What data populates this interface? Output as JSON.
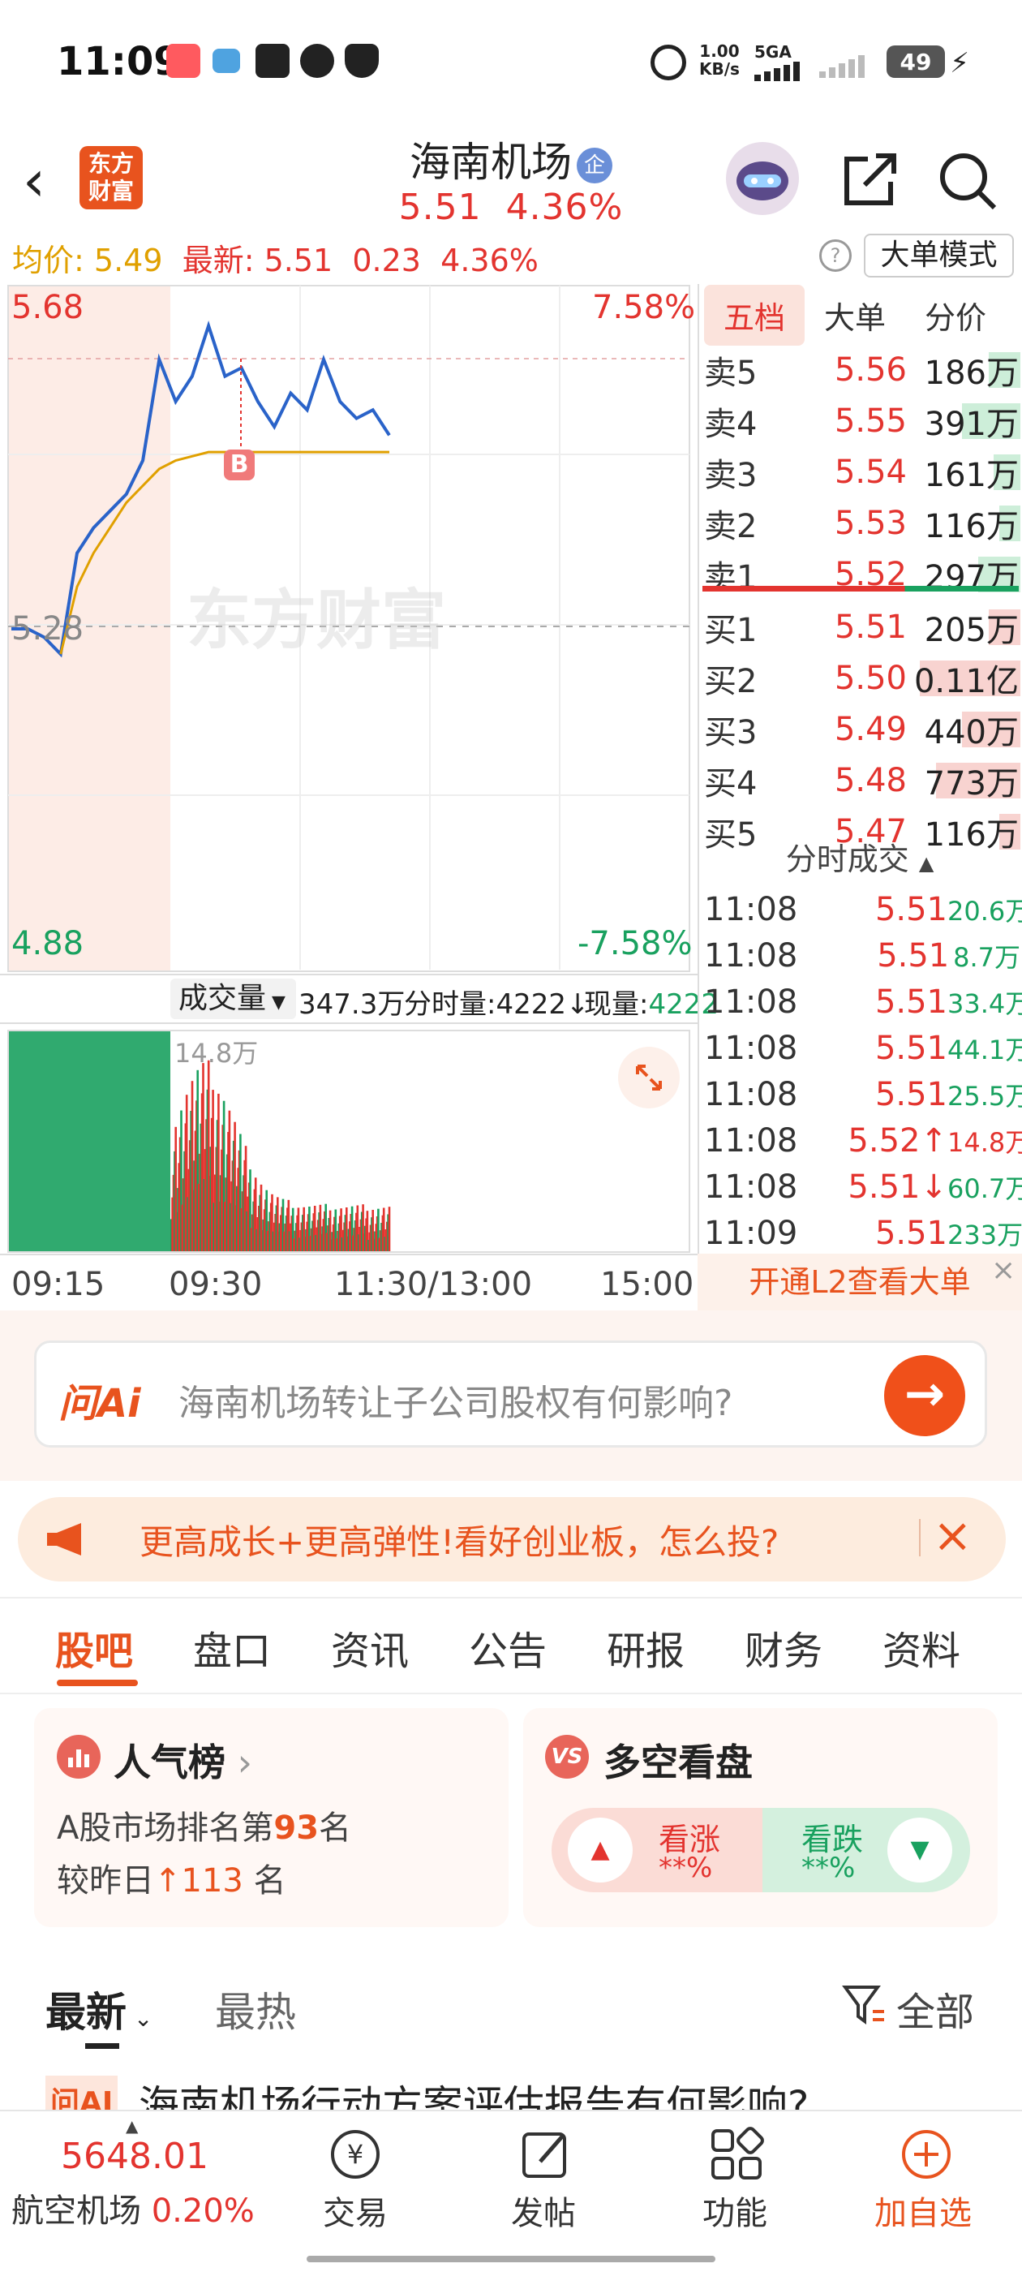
{
  "status_bar": {
    "time": "11:09",
    "net_speed": "1.00\nKB/s",
    "net_speed_top": "1.00",
    "net_speed_unit": "KB/s",
    "network": "5GA",
    "battery": "49"
  },
  "header": {
    "title": "海南机场",
    "badge": "企",
    "price": "5.51",
    "change_pct": "4.36%",
    "logo_line1": "东方",
    "logo_line2": "财富"
  },
  "info_row": {
    "avg_label": "均价:",
    "avg_value": "5.49",
    "latest_label": "最新:",
    "latest_value": "5.51",
    "change": "0.23",
    "change_pct": "4.36%",
    "mode_button": "大单模式"
  },
  "chart": {
    "price_high": "5.68",
    "price_mid": "5.28",
    "price_low": "4.88",
    "pct_high": "7.58%",
    "pct_low": "-7.58%",
    "watermark": "东方财富",
    "buy_marker": "B",
    "volume_label": "成交量",
    "volume_total": "347.3万",
    "tick_volume_label": "分时量:4222↓",
    "current_volume_label": "现量:",
    "current_volume": "4222",
    "volume_peak": "14.8万",
    "x_labels": [
      "09:15",
      "09:30",
      "11:30/13:00",
      "15:00"
    ]
  },
  "chart_data": {
    "type": "line",
    "x": [
      "09:15",
      "09:20",
      "09:25",
      "09:30",
      "09:35",
      "09:40",
      "09:45",
      "09:50",
      "09:55",
      "10:00",
      "10:05",
      "10:10",
      "10:15",
      "10:20",
      "10:25",
      "10:30",
      "10:35",
      "10:40",
      "10:45",
      "10:50",
      "10:55",
      "11:00",
      "11:05",
      "11:09"
    ],
    "series": [
      {
        "name": "",
        "values": [
          5.28,
          5.28,
          5.27,
          5.25,
          5.37,
          5.4,
          5.42,
          5.44,
          5.48,
          5.6,
          5.55,
          5.58,
          5.64,
          5.58,
          5.59,
          5.55,
          5.52,
          5.56,
          5.54,
          5.6,
          5.55,
          5.53,
          5.54,
          5.51
        ]
      },
      {
        "name": "",
        "values": [
          null,
          null,
          null,
          5.25,
          5.33,
          5.37,
          5.4,
          5.43,
          5.45,
          5.47,
          5.48,
          5.485,
          5.49,
          5.49,
          5.49,
          5.49,
          5.49,
          5.49,
          5.49,
          5.49,
          5.49,
          5.49,
          5.49,
          5.49
        ]
      }
    ],
    "ylim": [
      4.88,
      5.68
    ]
  },
  "ladder": {
    "tabs": [
      "五档",
      "大单",
      "分价"
    ],
    "asks": [
      {
        "name": "卖5",
        "price": "5.56",
        "vol": "186万",
        "bar": 0.3
      },
      {
        "name": "卖4",
        "price": "5.55",
        "vol": "391万",
        "bar": 0.55
      },
      {
        "name": "卖3",
        "price": "5.54",
        "vol": "161万",
        "bar": 0.25
      },
      {
        "name": "卖2",
        "price": "5.53",
        "vol": "116万",
        "bar": 0.2
      },
      {
        "name": "卖1",
        "price": "5.52",
        "vol": "297万",
        "bar": 0.4
      }
    ],
    "bids": [
      {
        "name": "买1",
        "price": "5.51",
        "vol": "205万",
        "bar": 0.3
      },
      {
        "name": "买2",
        "price": "5.50",
        "vol": "0.11亿",
        "bar": 0.95
      },
      {
        "name": "买3",
        "price": "5.49",
        "vol": "440万",
        "bar": 0.55
      },
      {
        "name": "买4",
        "price": "5.48",
        "vol": "773万",
        "bar": 0.8
      },
      {
        "name": "买5",
        "price": "5.47",
        "vol": "116万",
        "bar": 0.2
      }
    ],
    "ticks_title": "分时成交",
    "ticks": [
      {
        "time": "11:08",
        "price": "5.51",
        "vol": "20.6万",
        "color": "#19a15f"
      },
      {
        "time": "11:08",
        "price": "5.51",
        "vol": "8.7万",
        "color": "#19a15f"
      },
      {
        "time": "11:08",
        "price": "5.51",
        "vol": "33.4万",
        "color": "#19a15f"
      },
      {
        "time": "11:08",
        "price": "5.51",
        "vol": "44.1万",
        "color": "#19a15f"
      },
      {
        "time": "11:08",
        "price": "5.51",
        "vol": "25.5万",
        "color": "#19a15f"
      },
      {
        "time": "11:08",
        "price": "5.52↑",
        "vol": "14.8万",
        "color": "#e3342f"
      },
      {
        "time": "11:08",
        "price": "5.51↓",
        "vol": "60.7万",
        "color": "#19a15f"
      },
      {
        "time": "11:09",
        "price": "5.51",
        "vol": "233万",
        "color": "#19a15f"
      }
    ],
    "l2_text": "开通L2查看大单"
  },
  "ai_bar": {
    "tag": "问Ai",
    "question": "海南机场转让子公司股权有何影响?"
  },
  "promo": {
    "text": "更高成长+更高弹性!看好创业板，怎么投?"
  },
  "sections": [
    "股吧",
    "盘口",
    "资讯",
    "公告",
    "研报",
    "财务",
    "资料"
  ],
  "popularity": {
    "title": "人气榜",
    "rank_prefix": "A股市场排名第",
    "rank": "93",
    "rank_suffix": "名",
    "change_prefix": "较昨日",
    "change": "113",
    "change_suffix": "名"
  },
  "bull_bear": {
    "title": "多空看盘",
    "up_label": "看涨",
    "up_value": "**%",
    "down_label": "看跌",
    "down_value": "**%"
  },
  "feed": {
    "latest": "最新",
    "hot": "最热",
    "filter": "全部",
    "post_tag": "问AI",
    "post_title": "海南机场行动方案评估报告有何影响?"
  },
  "bottom_nav": {
    "index_value": "5648.01",
    "index_name": "航空机场",
    "index_change": "0.20%",
    "items": [
      "交易",
      "发帖",
      "功能",
      "加自选"
    ]
  }
}
